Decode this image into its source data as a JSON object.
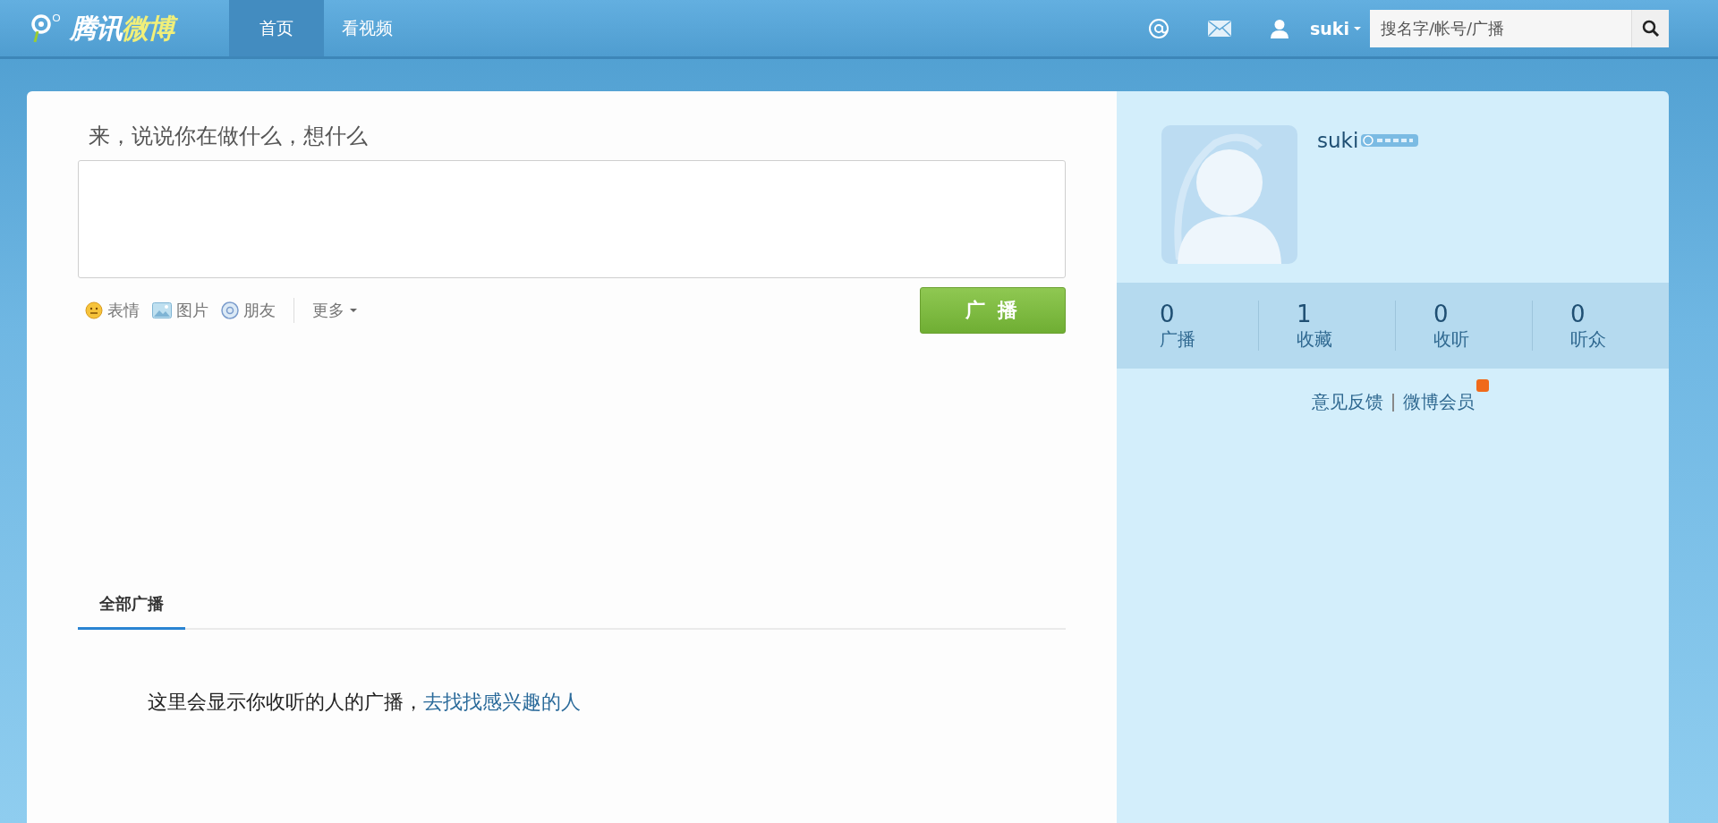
{
  "header": {
    "logo": {
      "text": "腾讯",
      "accent": "微博"
    },
    "nav_tabs": [
      {
        "label": "首页",
        "selected": true
      },
      {
        "label": "看视频",
        "selected": false
      }
    ],
    "username": "suki",
    "search": {
      "placeholder": "搜名字/帐号/广播"
    }
  },
  "composer": {
    "prompt": "来，说说你在做什么，想什么",
    "tools": [
      {
        "kind": "emoji",
        "label": "表情"
      },
      {
        "kind": "image",
        "label": "图片"
      },
      {
        "kind": "friend",
        "label": "朋友"
      },
      {
        "kind": "more",
        "label": "更多"
      }
    ],
    "submit": "广 播"
  },
  "feed": {
    "tabs": [
      {
        "label": "全部广播",
        "selected": true
      }
    ],
    "empty_message": "这里会显示你收听的人的广播，",
    "link": "去找找感兴趣的人"
  },
  "profile": {
    "name": "suki",
    "stats": [
      {
        "count": "0",
        "label": "广播"
      },
      {
        "count": "1",
        "label": "收藏"
      },
      {
        "count": "0",
        "label": "收听"
      },
      {
        "count": "0",
        "label": "听众"
      }
    ],
    "links": [
      {
        "label": "意见反馈",
        "new": false
      },
      {
        "label": "微博会员",
        "new": true
      }
    ]
  }
}
